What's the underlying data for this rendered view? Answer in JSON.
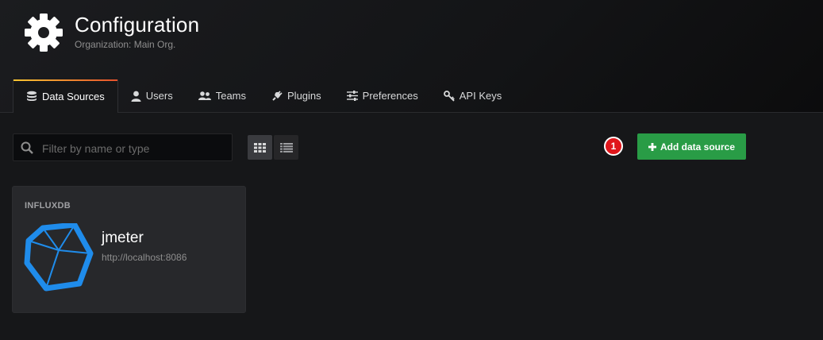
{
  "header": {
    "title": "Configuration",
    "subtitle": "Organization: Main Org.",
    "icon": "gear-icon"
  },
  "tabs": [
    {
      "label": "Data Sources",
      "icon": "database-icon",
      "active": true
    },
    {
      "label": "Users",
      "icon": "user-icon",
      "active": false
    },
    {
      "label": "Teams",
      "icon": "users-icon",
      "active": false
    },
    {
      "label": "Plugins",
      "icon": "plug-icon",
      "active": false
    },
    {
      "label": "Preferences",
      "icon": "sliders-icon",
      "active": false
    },
    {
      "label": "API Keys",
      "icon": "key-icon",
      "active": false
    }
  ],
  "toolbar": {
    "search_placeholder": "Filter by name or type",
    "search_value": "",
    "badge": "1",
    "add_button_label": "Add data source"
  },
  "datasources": [
    {
      "type": "INFLUXDB",
      "name": "jmeter",
      "url": "http://localhost:8086"
    }
  ],
  "colors": {
    "accent_green": "#299c46",
    "badge_red": "#e0161b",
    "influx_blue": "#1f8ceb",
    "background": "#161719"
  }
}
